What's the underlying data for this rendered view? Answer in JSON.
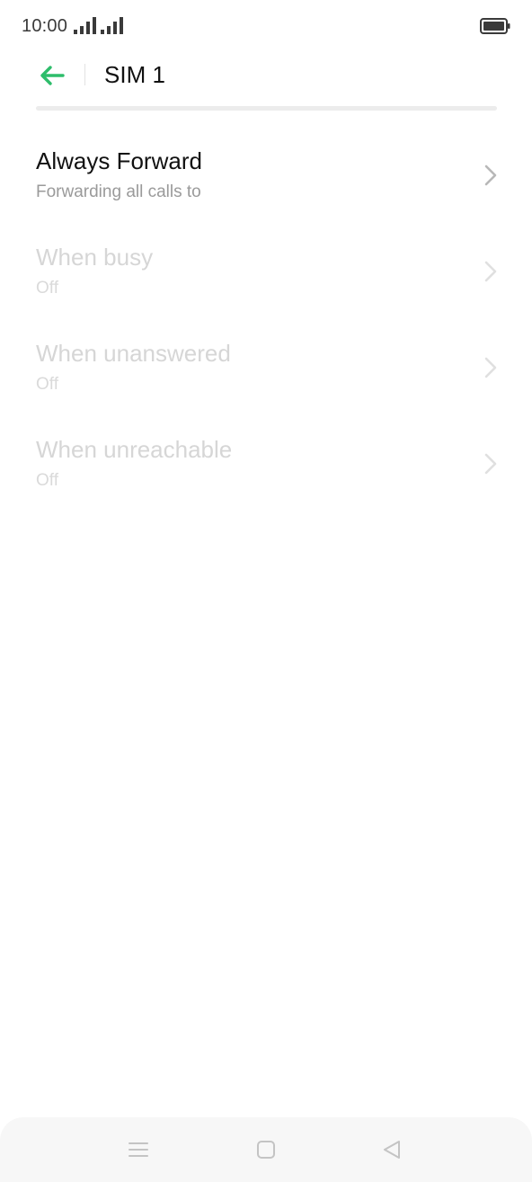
{
  "status_bar": {
    "time": "10:00"
  },
  "header": {
    "title": "SIM 1"
  },
  "colors": {
    "accent": "#2ebd6b",
    "title_enabled": "#111111",
    "subtitle_enabled": "#9a9a9a",
    "disabled_text": "#d6d6d6"
  },
  "forwarding_options": [
    {
      "title": "Always Forward",
      "subtitle": "Forwarding all calls to",
      "enabled": true
    },
    {
      "title": "When busy",
      "subtitle": "Off",
      "enabled": false
    },
    {
      "title": "When unanswered",
      "subtitle": "Off",
      "enabled": false
    },
    {
      "title": "When unreachable",
      "subtitle": "Off",
      "enabled": false
    }
  ],
  "icons": {
    "back": "arrow-left-icon",
    "chevron": "chevron-right-icon",
    "nav_menu": "menu-icon",
    "nav_home": "home-square-icon",
    "nav_back": "back-triangle-icon"
  }
}
